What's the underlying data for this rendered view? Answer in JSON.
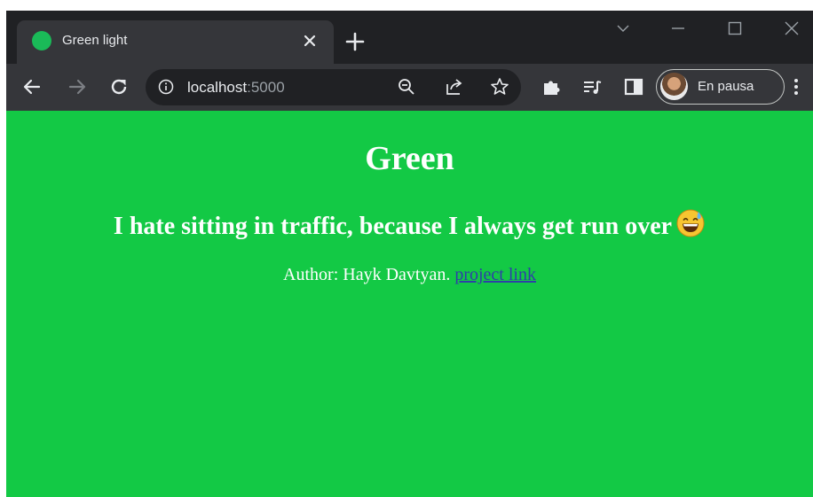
{
  "browser": {
    "tab": {
      "title": "Green light",
      "favicon_color": "#1aba58"
    },
    "new_tab_label": "+",
    "address": {
      "host": "localhost",
      "port": ":5000"
    },
    "profile": {
      "label": "En pausa"
    },
    "colors": {
      "frame": "#202124",
      "toolbar": "#35363a",
      "text": "#e8eaed"
    }
  },
  "page": {
    "background": "#13c945",
    "heading": "Green",
    "joke": "I hate sitting in traffic, because I always get run over",
    "joke_emoji": "grinning-face-with-sweat",
    "author_prefix": "Author: Hayk Davtyan.",
    "project_link": "project link",
    "link_color": "#2e3fa8"
  }
}
